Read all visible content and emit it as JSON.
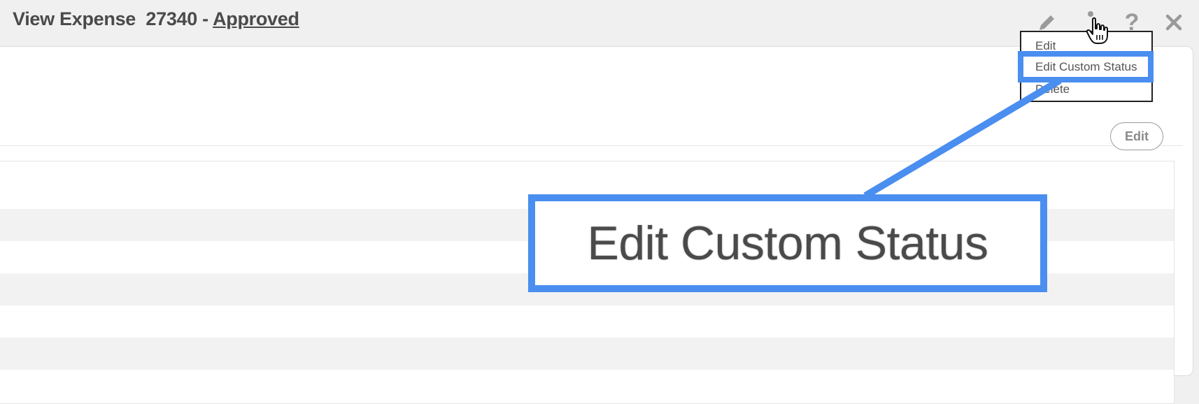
{
  "header": {
    "title_prefix": "View Expense  27340 - ",
    "status": "Approved"
  },
  "toolbar": {
    "icons": [
      "pencil-icon",
      "more-vertical-icon",
      "help-icon",
      "close-icon"
    ],
    "help_glyph": "?"
  },
  "menu": {
    "items": [
      {
        "label": "Edit"
      },
      {
        "label": "Edit Custom Status"
      },
      {
        "label": "Delete"
      }
    ],
    "highlighted_index": 1
  },
  "card": {
    "edit_label": "Edit"
  },
  "callout": {
    "text": "Edit Custom Status",
    "color": "#4a8ef0"
  }
}
